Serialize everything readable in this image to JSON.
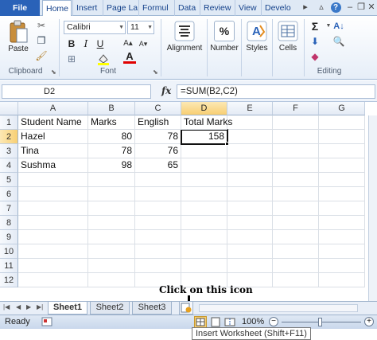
{
  "tabs": [
    "File",
    "Home",
    "Insert",
    "Page La",
    "Formul",
    "Data",
    "Review",
    "View",
    "Develo"
  ],
  "ribbon": {
    "paste_label": "Paste",
    "clipboard_label": "Clipboard",
    "font_name": "Calibri",
    "font_size": "11",
    "font_label": "Font",
    "bold": "B",
    "italic": "I",
    "underline": "U",
    "alignment_label": "Alignment",
    "number_label": "Number",
    "styles_label": "Styles",
    "cells_label": "Cells",
    "editing_label": "Editing",
    "sigma": "Σ",
    "percent": "%"
  },
  "formula_bar": {
    "name_box": "D2",
    "fx": "fx",
    "formula": "=SUM(B2,C2)"
  },
  "columns": [
    "A",
    "B",
    "C",
    "D",
    "E",
    "F",
    "G"
  ],
  "rows": [
    "1",
    "2",
    "3",
    "4",
    "5",
    "6",
    "7",
    "8",
    "9",
    "10",
    "11",
    "12"
  ],
  "cells": {
    "A1": "Student Name",
    "B1": "Marks",
    "C1": "English",
    "D1": "Total Marks",
    "A2": "Hazel",
    "B2": "80",
    "C2": "78",
    "D2": "158",
    "A3": "Tina",
    "B3": "78",
    "C3": "76",
    "A4": "Sushma",
    "B4": "98",
    "C4": "65"
  },
  "sheets": [
    "Sheet1",
    "Sheet2",
    "Sheet3"
  ],
  "callout": "Click on this icon",
  "status": {
    "ready": "Ready",
    "zoom": "100%",
    "tooltip": "Insert Worksheet (Shift+F11)"
  }
}
